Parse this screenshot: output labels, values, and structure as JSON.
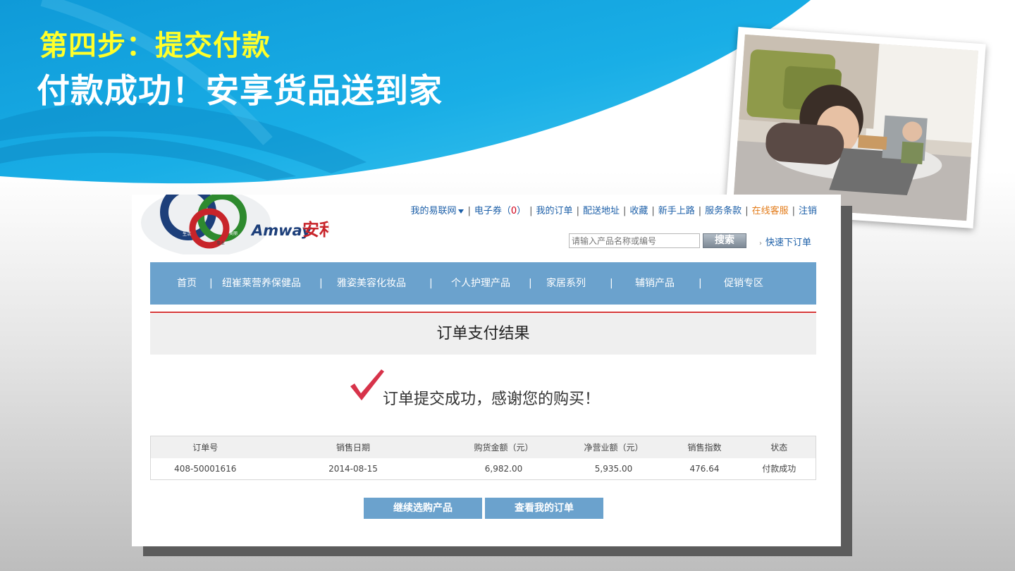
{
  "slide": {
    "step_title": "第四步：提交付款",
    "subtitle": "付款成功！安享货品送到家"
  },
  "colors": {
    "banner_blue": "#1ba6e0",
    "title_yellow": "#ffff2a",
    "nav_blue": "#6ba2cd",
    "accent_red": "#d63a3a",
    "link_blue": "#1c5fa8",
    "link_orange": "#e37c1a"
  },
  "logo": {
    "brand": "Amway",
    "brand_cn": "安利",
    "ring_labels": [
      "生活",
      "美丽",
      "事业"
    ]
  },
  "top_links": {
    "my_yilian": "我的易联网",
    "ecoupon_prefix": "电子券（",
    "ecoupon_count": "0",
    "ecoupon_suffix": "）",
    "my_orders": "我的订单",
    "delivery_address": "配送地址",
    "favorites": "收藏",
    "newbie": "新手上路",
    "terms": "服务条款",
    "online_service": "在线客服",
    "logout": "注销"
  },
  "search": {
    "placeholder": "请输入产品名称或编号",
    "button_label": "搜索",
    "quick_order": "快速下订单"
  },
  "nav": {
    "items": [
      "首页",
      "纽崔莱营养保健品",
      "雅姿美容化妆品",
      "个人护理产品",
      "家居系列",
      "辅销产品",
      "促销专区"
    ]
  },
  "result": {
    "heading": "订单支付结果",
    "message": "订单提交成功，感谢您的购买！"
  },
  "table": {
    "headers": [
      "订单号",
      "销售日期",
      "购货金额（元）",
      "净营业额（元）",
      "销售指数",
      "状态"
    ],
    "rows": [
      [
        "408-50001616",
        "2014-08-15",
        "6,982.00",
        "5,935.00",
        "476.64",
        "付款成功"
      ]
    ]
  },
  "actions": {
    "continue_shopping": "继续选购产品",
    "view_orders": "查看我的订单"
  }
}
